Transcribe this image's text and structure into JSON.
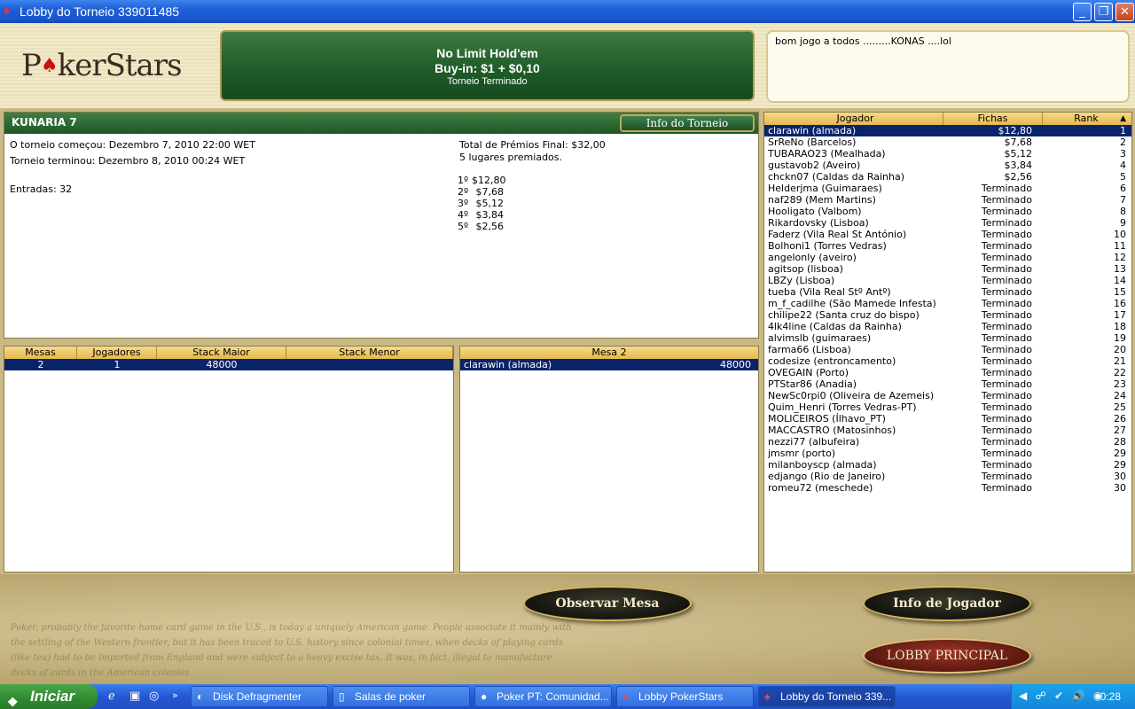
{
  "window": {
    "title": "Lobby do Torneio 339011485"
  },
  "header": {
    "logo": "PokerStars",
    "game": "No Limit Hold'em",
    "buyin": "Buy-in: $1 + $0,10",
    "status": "Torneio Terminado",
    "chat": "bom jogo a todos .........KONAS ....lol"
  },
  "info": {
    "name": "KUNARIA 7",
    "button": "Info do Torneio",
    "start_label": "O torneio começou:",
    "start_value": "Dezembro 7, 2010 22:00 WET",
    "end_label": "Torneio terminou:",
    "end_value": "Dezembro 8, 2010 00:24 WET",
    "entries_label": "Entradas:",
    "entries_value": "32",
    "prize_total": "Total de Prémios Final: $32,00",
    "places_paid": "5 lugares premiados.",
    "prizes": [
      {
        "place": "1º",
        "amount": "$12,80"
      },
      {
        "place": "2º",
        "amount": "$7,68"
      },
      {
        "place": "3º",
        "amount": "$5,12"
      },
      {
        "place": "4º",
        "amount": "$3,84"
      },
      {
        "place": "5º",
        "amount": "$2,56"
      }
    ]
  },
  "tables": {
    "headers": [
      "Mesas",
      "Jogadores",
      "Stack Maior",
      "Stack Menor"
    ],
    "rows": [
      [
        "2",
        "1",
        "48000",
        ""
      ]
    ]
  },
  "mesa": {
    "header": "Mesa 2",
    "rows": [
      [
        "clarawin (almada)",
        "48000"
      ]
    ]
  },
  "players": {
    "headers": [
      "Jogador",
      "Fichas",
      "Rank"
    ],
    "rows": [
      [
        "clarawin (almada)",
        "$12,80",
        "1"
      ],
      [
        "SrReNo (Barcelos)",
        "$7,68",
        "2"
      ],
      [
        "TUBARAO23 (Mealhada)",
        "$5,12",
        "3"
      ],
      [
        "gustavob2 (Aveiro)",
        "$3,84",
        "4"
      ],
      [
        "chckn07 (Caldas da Rainha)",
        "$2,56",
        "5"
      ],
      [
        "Helderjma (Guimaraes)",
        "Terminado",
        "6"
      ],
      [
        "naf289 (Mem Martins)",
        "Terminado",
        "7"
      ],
      [
        "Hooligato (Valbom)",
        "Terminado",
        "8"
      ],
      [
        "Rikardovsky (Lisboa)",
        "Terminado",
        "9"
      ],
      [
        "Faderz (Vila Real St António)",
        "Terminado",
        "10"
      ],
      [
        "Bolhoni1 (Torres Vedras)",
        "Terminado",
        "11"
      ],
      [
        "angelonly (aveiro)",
        "Terminado",
        "12"
      ],
      [
        "agitsop (lisboa)",
        "Terminado",
        "13"
      ],
      [
        "LBZy (Lisboa)",
        "Terminado",
        "14"
      ],
      [
        "tueba (Vila Real Stº Antº)",
        "Terminado",
        "15"
      ],
      [
        "m_f_cadilhe (São Mamede Infesta)",
        "Terminado",
        "16"
      ],
      [
        "chilipe22 (Santa cruz do bispo)",
        "Terminado",
        "17"
      ],
      [
        "4lk4line (Caldas da Rainha)",
        "Terminado",
        "18"
      ],
      [
        "alvimslb (guimaraes)",
        "Terminado",
        "19"
      ],
      [
        "farma66 (Lisboa)",
        "Terminado",
        "20"
      ],
      [
        "codesize (entroncamento)",
        "Terminado",
        "21"
      ],
      [
        "OVEGAIN (Porto)",
        "Terminado",
        "22"
      ],
      [
        "PTStar86 (Anadia)",
        "Terminado",
        "23"
      ],
      [
        "NewSc0rpi0 (Oliveira de Azemeis)",
        "Terminado",
        "24"
      ],
      [
        "Quim_Henri (Torres Vedras-PT)",
        "Terminado",
        "25"
      ],
      [
        "MOLICEIROS (Ílhavo_PT)",
        "Terminado",
        "26"
      ],
      [
        "MACCASTRO (Matosinhos)",
        "Terminado",
        "27"
      ],
      [
        "nezzi77 (albufeira)",
        "Terminado",
        "28"
      ],
      [
        "jmsmr (porto)",
        "Terminado",
        "29"
      ],
      [
        "milanboyscp (almada)",
        "Terminado",
        "29"
      ],
      [
        "edjango (Rio de Janeiro)",
        "Terminado",
        "30"
      ],
      [
        "romeu72 (meschede)",
        "Terminado",
        "30"
      ]
    ]
  },
  "buttons": {
    "observe": "Observar Mesa",
    "player_info": "Info de Jogador",
    "main_lobby": "LOBBY PRINCIPAL"
  },
  "background_text": "Poker, probably the favorite home card game in the U.S., is today a uniquely American game. People associate it mainly with the settling of the Western frontier, but it has been traced to U.S. history since colonial times, when decks of playing cards (like tea) had to be imported from England and were subject to a heavy excise tax. It was, in fact, illegal to manufacture decks of cards in the American colonies.",
  "taskbar": {
    "start": "Iniciar",
    "items": [
      "Disk Defragmenter",
      "Salas de poker",
      "Poker PT: Comunidad...",
      "Lobby PokerStars",
      "Lobby do Torneio 339..."
    ],
    "clock": "0:28"
  }
}
